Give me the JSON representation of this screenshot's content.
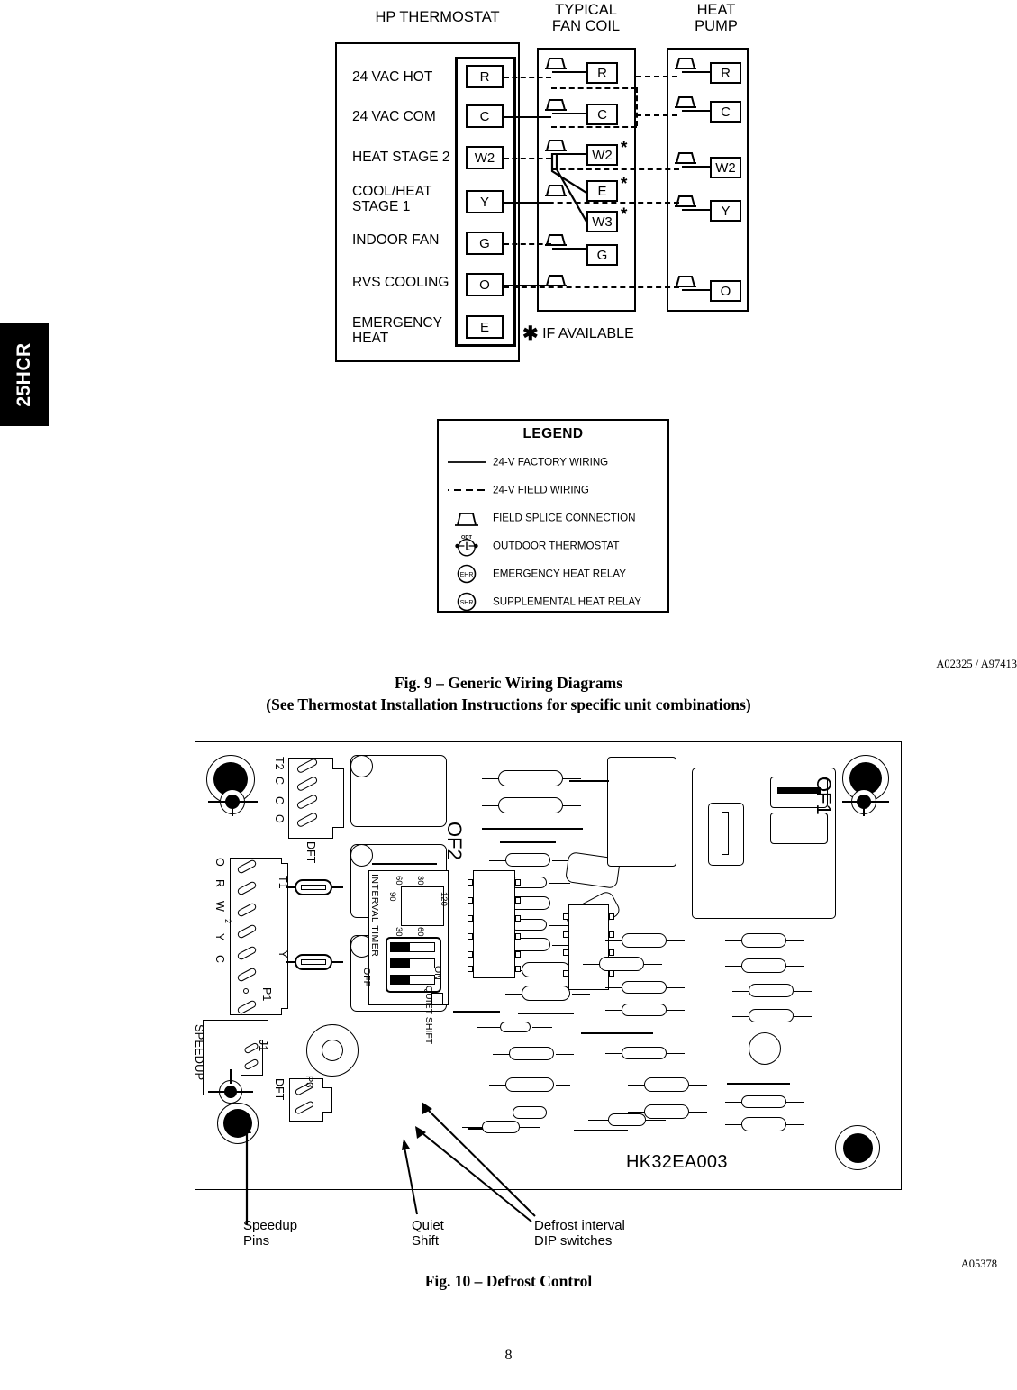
{
  "page": {
    "side_tab": "25HCR",
    "page_number": "8"
  },
  "fig9": {
    "headers": {
      "thermostat": "HP THERMOSTAT",
      "fan_coil": "TYPICAL\nFAN COIL",
      "heat_pump": "HEAT\nPUMP"
    },
    "thermostat_rows": [
      {
        "label": "24 VAC HOT",
        "terminal": "R"
      },
      {
        "label": "24 VAC COM",
        "terminal": "C"
      },
      {
        "label": "HEAT STAGE 2",
        "terminal": "W2"
      },
      {
        "label": "COOL/HEAT\nSTAGE 1",
        "terminal": "Y"
      },
      {
        "label": "INDOOR FAN",
        "terminal": "G"
      },
      {
        "label": "RVS COOLING",
        "terminal": "O"
      },
      {
        "label": "EMERGENCY\nHEAT",
        "terminal": "E"
      }
    ],
    "fan_coil_terminals": [
      {
        "terminal": "R",
        "star": false
      },
      {
        "terminal": "C",
        "star": false
      },
      {
        "terminal": "W2",
        "star": true
      },
      {
        "terminal": "E",
        "star": true
      },
      {
        "terminal": "W3",
        "star": true
      },
      {
        "terminal": "G",
        "star": false
      }
    ],
    "heat_pump_terminals": [
      {
        "terminal": "R"
      },
      {
        "terminal": "C"
      },
      {
        "terminal": "W2"
      },
      {
        "terminal": "Y"
      },
      {
        "terminal": "O"
      }
    ],
    "footnote": "IF AVAILABLE",
    "footnote_marker": "*",
    "legend": {
      "title": "LEGEND",
      "items": [
        {
          "symbol": "solid-line",
          "label": "24-V FACTORY WIRING"
        },
        {
          "symbol": "dashed-line",
          "label": "24-V FIELD WIRING"
        },
        {
          "symbol": "splice",
          "label": "FIELD SPLICE CONNECTION"
        },
        {
          "symbol": "odt",
          "label": "OUTDOOR THERMOSTAT",
          "inner": "ODT"
        },
        {
          "symbol": "relay",
          "label": "EMERGENCY HEAT RELAY",
          "inner": "EHR"
        },
        {
          "symbol": "relay",
          "label": "SUPPLEMENTAL HEAT RELAY",
          "inner": "SHR"
        }
      ]
    },
    "art_id": "A02325 / A97413",
    "caption_line1": "Fig. 9  –  Generic Wiring Diagrams",
    "caption_line2": "(See Thermostat Installation Instructions for specific unit combinations)"
  },
  "fig10": {
    "board_name": "HK32EA003",
    "connector_p2": {
      "pins": [
        "T2",
        "C",
        "C",
        "O"
      ],
      "name": "DFT"
    },
    "connector_p1": {
      "pins": [
        "O",
        "R",
        "W",
        "2",
        "Y",
        "C"
      ],
      "name": "P1"
    },
    "speedup": {
      "label": "SPEEDUP",
      "jumper": "J1"
    },
    "dft_connector": "DFT",
    "p3": "P3",
    "fuses": [
      {
        "name": "T1"
      },
      {
        "name": "Y"
      }
    ],
    "outputs": [
      {
        "name": "OF2"
      },
      {
        "name": "OF1"
      }
    ],
    "dip": {
      "title": "INTERVAL  TIMER",
      "off": "OFF",
      "on": "ON",
      "quiet_shift": "QUIET\nSHIFT",
      "matrix": {
        "top_left": "60",
        "top_right": "30",
        "right": "120",
        "left": "90",
        "bottom_left": "30",
        "bottom_right": "60"
      }
    },
    "callouts": [
      {
        "label": "Speedup\nPins"
      },
      {
        "label": "Quiet\nShift"
      },
      {
        "label": "Defrost interval\nDIP switches"
      }
    ],
    "art_id": "A05378",
    "caption": "Fig. 10  –  Defrost Control"
  }
}
